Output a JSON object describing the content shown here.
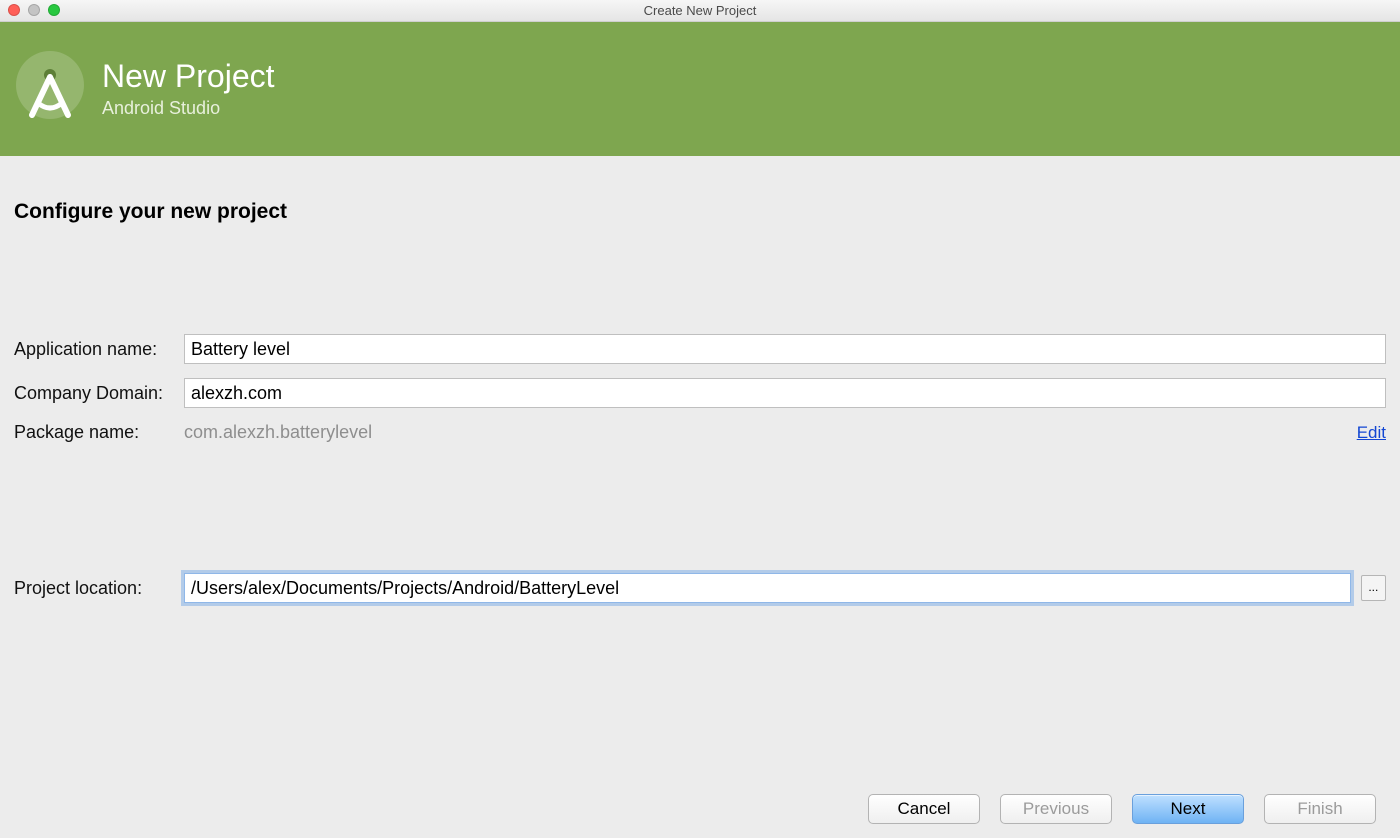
{
  "window": {
    "title": "Create New Project"
  },
  "header": {
    "title": "New Project",
    "subtitle": "Android Studio"
  },
  "section": {
    "title": "Configure your new project"
  },
  "form": {
    "app_name_label": "Application name:",
    "app_name_value": "Battery level",
    "company_domain_label": "Company Domain:",
    "company_domain_value": "alexzh.com",
    "package_name_label": "Package name:",
    "package_name_value": "com.alexzh.batterylevel",
    "edit_link": "Edit",
    "project_location_label": "Project location:",
    "project_location_value": "/Users/alex/Documents/Projects/Android/BatteryLevel",
    "browse_label": "..."
  },
  "buttons": {
    "cancel": "Cancel",
    "previous": "Previous",
    "next": "Next",
    "finish": "Finish"
  }
}
